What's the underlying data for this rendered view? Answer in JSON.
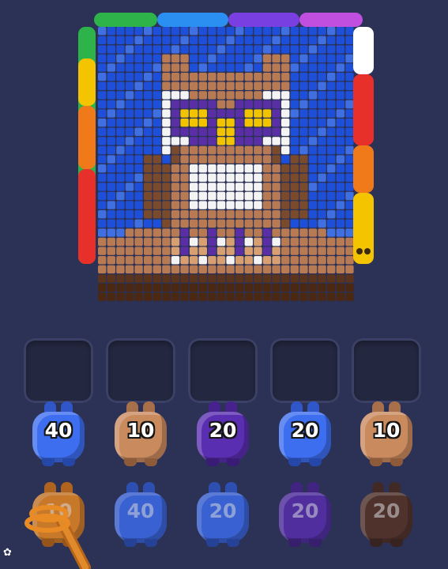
{
  "slots": [
    {},
    {},
    {},
    {},
    {}
  ],
  "jars_row1": [
    {
      "count": "40",
      "color": "blue"
    },
    {
      "count": "10",
      "color": "tan"
    },
    {
      "count": "20",
      "color": "purple"
    },
    {
      "count": "20",
      "color": "blue"
    },
    {
      "count": "10",
      "color": "tan"
    }
  ],
  "jars_row2": [
    {
      "count": "10",
      "color": "orange"
    },
    {
      "count": "40",
      "color": "blue"
    },
    {
      "count": "20",
      "color": "blue"
    },
    {
      "count": "20",
      "color": "purple"
    },
    {
      "count": "20",
      "color": "brown"
    }
  ],
  "colors": {
    "background": "#2c3156",
    "board_blue": "#1d4fd9",
    "owl_brown": "#b87a52",
    "owl_dark": "#7a4a2c",
    "glasses_yellow": "#f2c400",
    "glasses_purple": "#5a2fa5",
    "white": "#f4f4f4",
    "jar_blue": "#3d6ef0",
    "jar_tan": "#c98a5e",
    "jar_purple": "#5a2eb0",
    "jar_orange": "#f08a1e",
    "jar_brown": "#5a3322"
  },
  "icons": {
    "corner": "settings-gear-icon",
    "snake": "yellow-snake-character"
  }
}
